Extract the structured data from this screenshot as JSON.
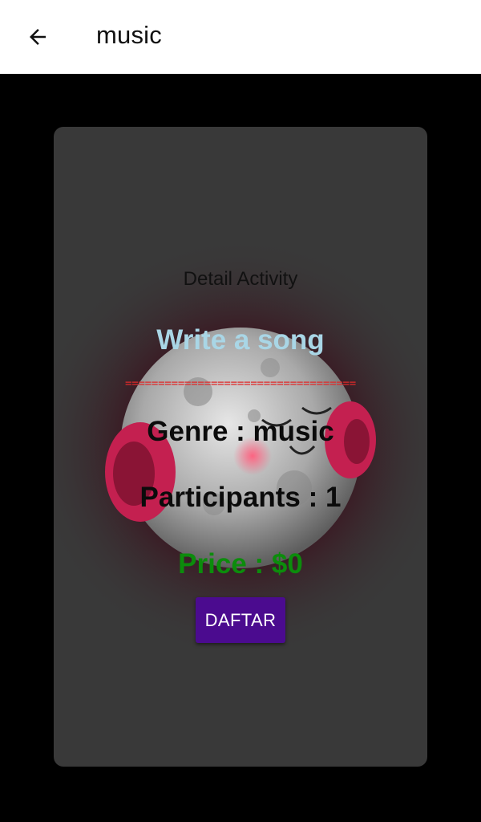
{
  "appbar": {
    "back_icon": "arrow-left-icon",
    "title": "music"
  },
  "card": {
    "background_art": "moon-with-headphones-illustration",
    "detail_label": "Detail Activity",
    "activity_title": "Write a song",
    "divider": "===================================",
    "genre": "Genre : music",
    "participants": "Participants : 1",
    "price": "Price : $0",
    "button_label": "DAFTAR"
  },
  "colors": {
    "appbar_bg": "#ffffff",
    "page_bg": "#000000",
    "card_bg": "#393939",
    "title_color": "#a9d6e6",
    "divider_color": "#e02a2a",
    "price_color": "#0c8c0c",
    "button_bg": "#4b0b8f",
    "headphones": "#d2245a"
  }
}
